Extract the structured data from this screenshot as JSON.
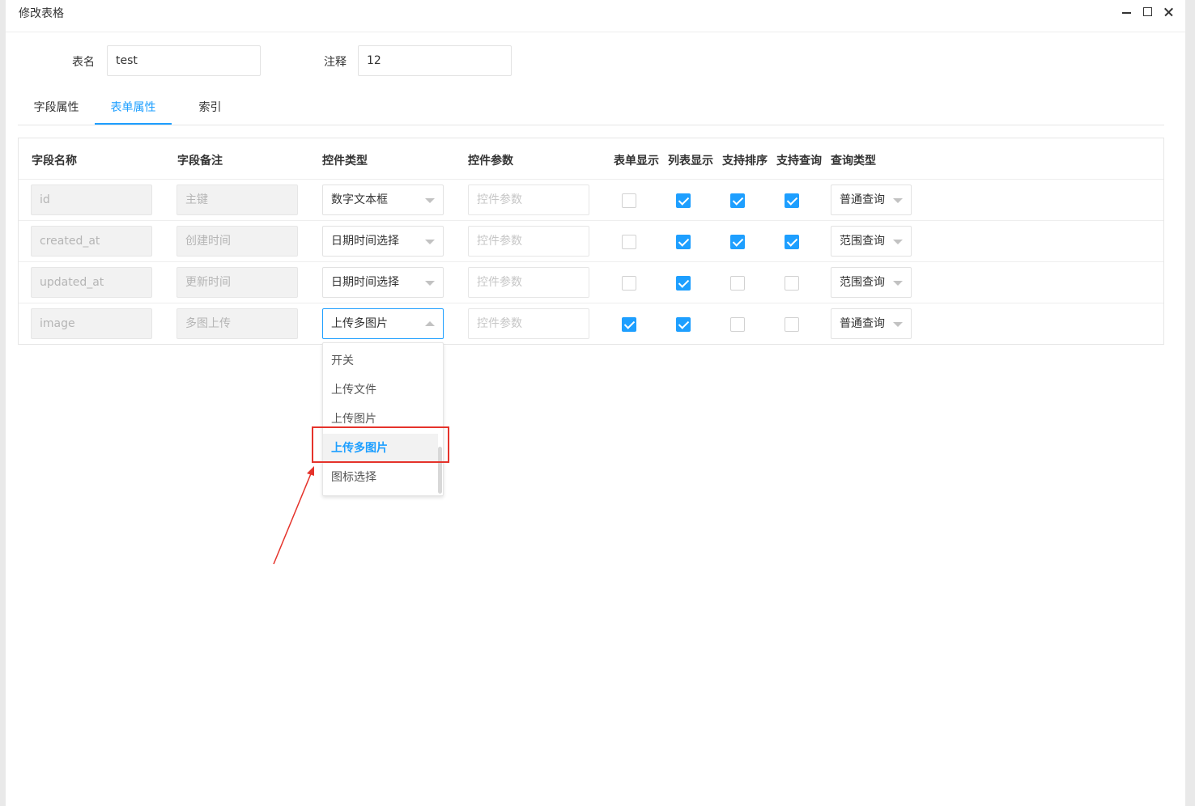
{
  "window": {
    "title": "修改表格"
  },
  "form": {
    "table_name_label": "表名",
    "table_name_value": "test",
    "comment_label": "注释",
    "comment_value": "12"
  },
  "tabs": [
    {
      "label": "字段属性",
      "active": false
    },
    {
      "label": "表单属性",
      "active": true
    },
    {
      "label": "索引",
      "active": false
    }
  ],
  "table": {
    "headers": [
      "字段名称",
      "字段备注",
      "控件类型",
      "控件参数",
      "表单显示",
      "列表显示",
      "支持排序",
      "支持查询",
      "查询类型"
    ],
    "param_placeholder": "控件参数",
    "rows": [
      {
        "name": "id",
        "remark": "主键",
        "control": "数字文本框",
        "form_show": false,
        "list_show": true,
        "sortable": true,
        "searchable": true,
        "query_type": "普通查询"
      },
      {
        "name": "created_at",
        "remark": "创建时间",
        "control": "日期时间选择",
        "form_show": false,
        "list_show": true,
        "sortable": true,
        "searchable": true,
        "query_type": "范围查询"
      },
      {
        "name": "updated_at",
        "remark": "更新时间",
        "control": "日期时间选择",
        "form_show": false,
        "list_show": true,
        "sortable": false,
        "searchable": false,
        "query_type": "范围查询"
      },
      {
        "name": "image",
        "remark": "多图上传",
        "control": "上传多图片",
        "form_show": true,
        "list_show": true,
        "sortable": false,
        "searchable": false,
        "query_type": "普通查询"
      }
    ]
  },
  "dropdown": {
    "options": [
      "开关",
      "上传文件",
      "上传图片",
      "上传多图片",
      "图标选择"
    ],
    "selected": "上传多图片"
  },
  "colors": {
    "accent": "#1e9fff",
    "highlight": "#e5332b"
  }
}
